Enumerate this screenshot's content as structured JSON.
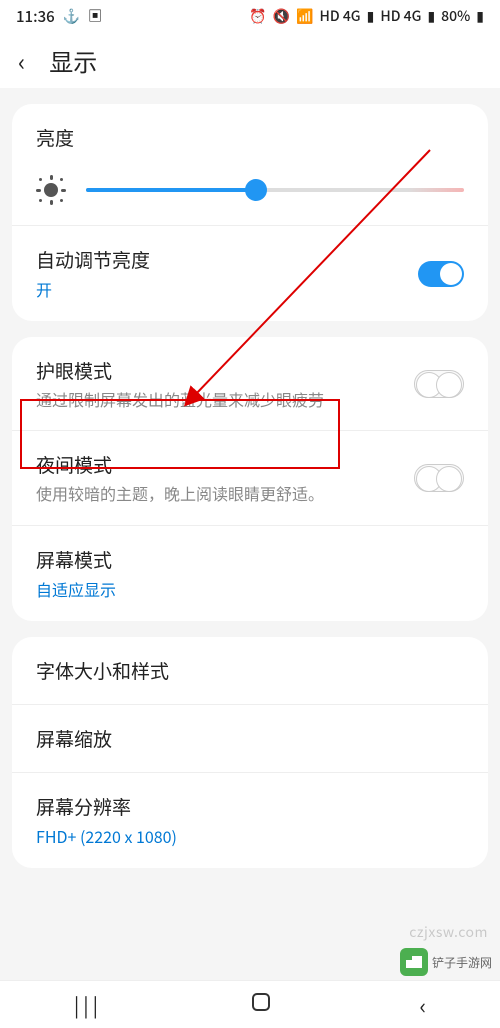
{
  "status": {
    "time": "11:36",
    "battery": "80%",
    "indicators": [
      "HD 4G",
      "HD 4G"
    ]
  },
  "header": {
    "title": "显示"
  },
  "brightness": {
    "label": "亮度",
    "value_pct": 45
  },
  "auto_brightness": {
    "title": "自动调节亮度",
    "state": "开",
    "on": true
  },
  "eye_comfort": {
    "title": "护眼模式",
    "desc": "通过限制屏幕发出的蓝光量来减少眼疲劳",
    "on": false
  },
  "night_mode": {
    "title": "夜间模式",
    "desc": "使用较暗的主题，晚上阅读眼睛更舒适。",
    "on": false
  },
  "screen_mode": {
    "title": "屏幕模式",
    "value": "自适应显示"
  },
  "font": {
    "title": "字体大小和样式"
  },
  "zoom": {
    "title": "屏幕缩放"
  },
  "resolution": {
    "title": "屏幕分辨率",
    "value": "FHD+ (2220 x 1080)"
  },
  "watermark": {
    "name": "铲子手游网",
    "url": "czjxsw.com"
  }
}
